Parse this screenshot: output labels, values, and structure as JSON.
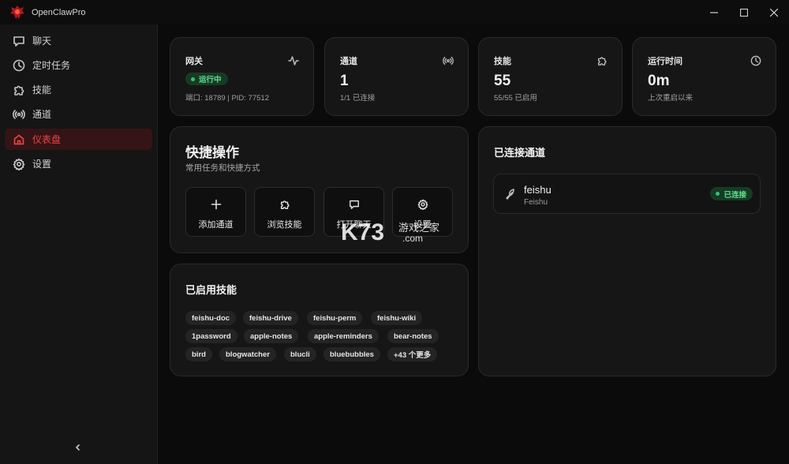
{
  "app": {
    "title": "OpenClawPro"
  },
  "sidebar": {
    "items": [
      {
        "label": "聊天",
        "icon": "chat-icon"
      },
      {
        "label": "定时任务",
        "icon": "clock-icon"
      },
      {
        "label": "技能",
        "icon": "puzzle-icon"
      },
      {
        "label": "通道",
        "icon": "broadcast-icon"
      },
      {
        "label": "仪表盘",
        "icon": "home-icon",
        "active": true
      },
      {
        "label": "设置",
        "icon": "gear-icon"
      }
    ]
  },
  "stats": {
    "gateway": {
      "title": "网关",
      "status": "运行中",
      "sub": "端口: 18789 | PID: 77512",
      "icon": "activity-icon"
    },
    "channels": {
      "title": "通道",
      "value": "1",
      "sub": "1/1 已连接",
      "icon": "broadcast-icon"
    },
    "skills": {
      "title": "技能",
      "value": "55",
      "sub": "55/55 已启用",
      "icon": "puzzle-icon"
    },
    "uptime": {
      "title": "运行时间",
      "value": "0m",
      "sub": "上次重启以来",
      "icon": "clock-icon"
    }
  },
  "quick_actions": {
    "title": "快捷操作",
    "subtitle": "常用任务和快捷方式",
    "buttons": [
      {
        "label": "添加通道",
        "icon": "plus-icon"
      },
      {
        "label": "浏览技能",
        "icon": "puzzle-icon"
      },
      {
        "label": "打开聊天",
        "icon": "chat-icon"
      },
      {
        "label": "设置",
        "icon": "gear-icon"
      }
    ]
  },
  "enabled_skills": {
    "title": "已启用技能",
    "chips": [
      "feishu-doc",
      "feishu-drive",
      "feishu-perm",
      "feishu-wiki",
      "1password",
      "apple-notes",
      "apple-reminders",
      "bear-notes",
      "bird",
      "blogwatcher",
      "blucli",
      "bluebubbles",
      "+43 个更多"
    ]
  },
  "connected_channels": {
    "title": "已连接通道",
    "items": [
      {
        "name": "feishu",
        "sub": "Feishu",
        "status": "已连接",
        "icon": "bird-icon"
      }
    ]
  },
  "watermark": {
    "brand": "K73",
    "text": "游戏之家",
    "domain": ".com"
  },
  "colors": {
    "accent": "#ef4444",
    "status_green": "#5fe08f",
    "status_green_bg": "#163b24"
  }
}
